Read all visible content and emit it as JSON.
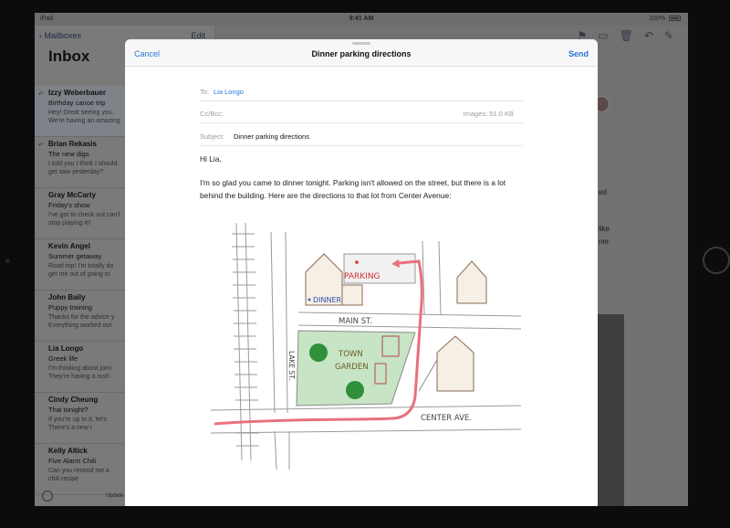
{
  "status_bar": {
    "device": "iPad",
    "time": "9:41 AM",
    "battery": "100%"
  },
  "mailbox": {
    "back_label": "Mailboxes",
    "edit_label": "Edit",
    "title": "Inbox",
    "items": [
      {
        "name": "Izzy Weberbauer",
        "subject": "Birthday canoe trip",
        "preview": "Hey! Great seeing you. We're having an amazing time at my birthday"
      },
      {
        "name": "Brian Rekasis",
        "subject": "The new digs",
        "preview": "I told you I think I should get saw yesterday? Seems"
      },
      {
        "name": "Gray McCarty",
        "subject": "Friday's show",
        "preview": "I've got to check out can't stop playing it!!"
      },
      {
        "name": "Kevin Angel",
        "subject": "Summer getaway",
        "preview": "Road trip! I'm totally do get me out of going to"
      },
      {
        "name": "John Baily",
        "subject": "Puppy training",
        "preview": "Thanks for the advice y Everything worked out"
      },
      {
        "name": "Lia Longo",
        "subject": "Greek life",
        "preview": "I'm thinking about joini They're having a rush"
      },
      {
        "name": "Cindy Cheung",
        "subject": "Thai tonight?",
        "preview": "If you're up to it, let's There's a new r"
      },
      {
        "name": "Kelly Altick",
        "subject": "Five Alarm Chili",
        "preview": "Can you resend me a chili recipe"
      }
    ],
    "updated_label": "Update"
  },
  "detail": {
    "snippets": [
      "ed",
      "like",
      "ner"
    ]
  },
  "compose": {
    "cancel_label": "Cancel",
    "title": "Dinner parking directions",
    "send_label": "Send",
    "to_label": "To:",
    "to_value": "Lia Longo",
    "ccbcc_label": "Cc/Bcc:",
    "images_label": "Images: 51.0 KB",
    "subject_label": "Subject:",
    "subject_value": "Dinner parking directions",
    "greeting": "Hi Lia,",
    "body": "I'm so glad you came to dinner tonight. Parking isn't allowed on the street, but there is a lot behind the building. Here are the directions to that lot from Center Avenue:"
  },
  "map": {
    "parking_label": "PARKING",
    "dinner_label": "DINNER",
    "main_st_label": "MAIN ST.",
    "lake_st_label": "LAKE ST.",
    "town_garden_label_1": "TOWN",
    "town_garden_label_2": "GARDEN",
    "center_ave_label": "CENTER AVE."
  },
  "colors": {
    "accent": "#2b75d8",
    "route": "#e8707e",
    "garden": "#c7e5c4"
  }
}
